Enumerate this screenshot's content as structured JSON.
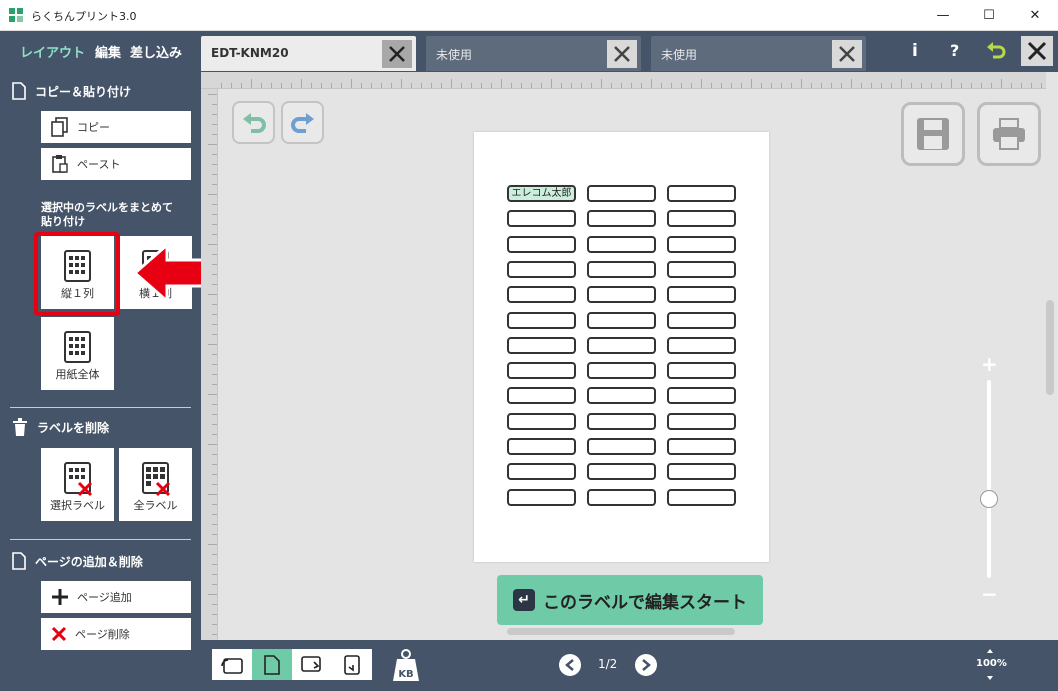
{
  "window": {
    "title": "らくちんプリント3.0",
    "minimize": "—",
    "maximize": "☐",
    "close": "✕"
  },
  "modes": {
    "layout": "レイアウト",
    "edit": "編集",
    "merge": "差し込み"
  },
  "tabs": [
    {
      "label": "EDT-KNM20"
    },
    {
      "label": "未使用"
    },
    {
      "label": "未使用"
    }
  ],
  "toolbar": {
    "info": "i",
    "help": "?"
  },
  "sidebar": {
    "copy_paste": {
      "title": "コピー＆貼り付け",
      "copy": "コピー",
      "paste": "ペースト"
    },
    "bulk_paste": {
      "title_line1": "選択中のラベルをまとめて",
      "title_line2": "貼り付け",
      "vertical": "縦１列",
      "horizontal": "横１列",
      "whole": "用紙全体"
    },
    "delete": {
      "title": "ラベルを削除",
      "selected": "選択ラベル",
      "all": "全ラベル"
    },
    "pages": {
      "title": "ページの追加＆削除",
      "add": "ページ追加",
      "remove": "ページ削除"
    }
  },
  "sheet": {
    "label_text": "エレコム太郎",
    "rows": 13,
    "cols": 3
  },
  "start_button": "このラベルで編集スタート",
  "zoom": {
    "plus": "+",
    "minus": "−",
    "level_percent": 60,
    "indicator": "100%"
  },
  "pager": {
    "indicator": "1/2"
  },
  "colors": {
    "accent": "#6fcaa8",
    "chrome": "#455468",
    "highlight": "#e60012"
  }
}
